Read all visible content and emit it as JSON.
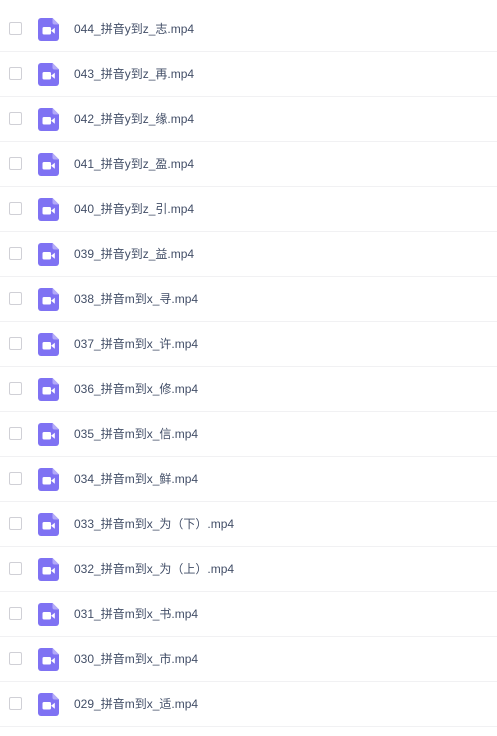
{
  "file_list": {
    "icon": "video-file-icon",
    "accent_color": "#7f72f3",
    "items": [
      {
        "name": "044_拼音y到z_志.mp4"
      },
      {
        "name": "043_拼音y到z_再.mp4"
      },
      {
        "name": "042_拼音y到z_缘.mp4"
      },
      {
        "name": "041_拼音y到z_盈.mp4"
      },
      {
        "name": "040_拼音y到z_引.mp4"
      },
      {
        "name": "039_拼音y到z_益.mp4"
      },
      {
        "name": "038_拼音m到x_寻.mp4"
      },
      {
        "name": "037_拼音m到x_许.mp4"
      },
      {
        "name": "036_拼音m到x_修.mp4"
      },
      {
        "name": "035_拼音m到x_信.mp4"
      },
      {
        "name": "034_拼音m到x_鲜.mp4"
      },
      {
        "name": "033_拼音m到x_为（下）.mp4"
      },
      {
        "name": "032_拼音m到x_为（上）.mp4"
      },
      {
        "name": "031_拼音m到x_书.mp4"
      },
      {
        "name": "030_拼音m到x_市.mp4"
      },
      {
        "name": "029_拼音m到x_适.mp4"
      }
    ]
  }
}
